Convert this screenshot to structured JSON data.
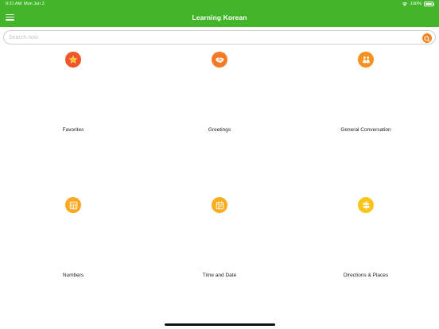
{
  "status": {
    "time": "9:21 AM",
    "date": "Mon Jun 3",
    "battery": "100%"
  },
  "header": {
    "title": "Learning Korean",
    "color": "#43b52b"
  },
  "search": {
    "placeholder": "Search now",
    "value": ""
  },
  "categories": [
    {
      "label": "Favorites",
      "icon": "star-icon",
      "color": "#f1562a"
    },
    {
      "label": "Greetings",
      "icon": "handshake-icon",
      "color": "#f47a26"
    },
    {
      "label": "General Conversation",
      "icon": "people-icon",
      "color": "#f7901e"
    },
    {
      "label": "Numbers",
      "icon": "abacus-icon",
      "color": "#f9a81f"
    },
    {
      "label": "Time and Date",
      "icon": "calendar-icon",
      "color": "#f8ae1c"
    },
    {
      "label": "Directions & Places",
      "icon": "signpost-icon",
      "color": "#fbc41a"
    }
  ]
}
